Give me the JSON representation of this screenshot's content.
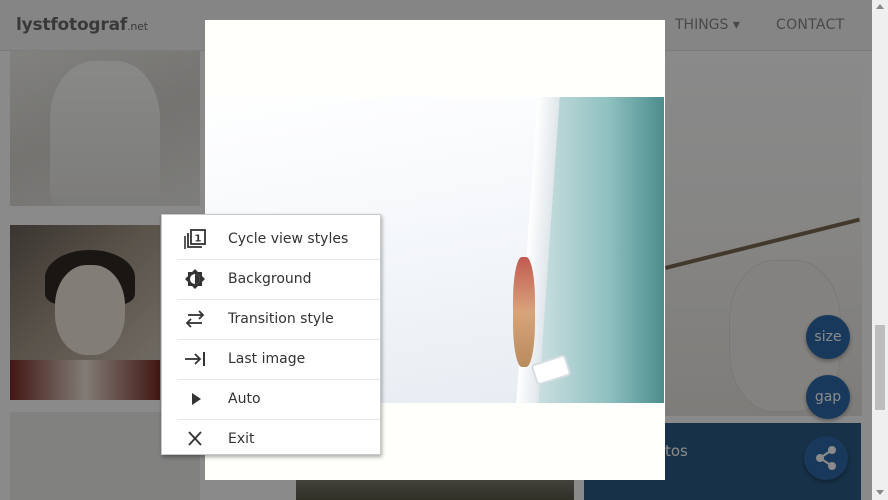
{
  "site": {
    "brand": "lystfotograf",
    "brand_suffix": ".net",
    "nav": [
      {
        "label": "THINGS ▾"
      },
      {
        "label": "CONTACT"
      }
    ]
  },
  "background": {
    "panel_text": "tos",
    "fabs": {
      "size": "size",
      "gap": "gap",
      "share_icon": "share-icon"
    }
  },
  "context_menu": {
    "items": [
      {
        "label": "Cycle view styles",
        "icon": "cycle-view-styles-icon"
      },
      {
        "label": "Background",
        "icon": "brightness-icon"
      },
      {
        "label": "Transition style",
        "icon": "swap-horizontal-icon"
      },
      {
        "label": "Last image",
        "icon": "last-image-icon"
      },
      {
        "label": "Auto",
        "icon": "play-icon"
      },
      {
        "label": "Exit",
        "icon": "close-icon"
      }
    ]
  },
  "colors": {
    "accent": "#2d6aa8",
    "panel": "#2c5c86",
    "overlay": "rgba(0,0,0,0.46)"
  }
}
